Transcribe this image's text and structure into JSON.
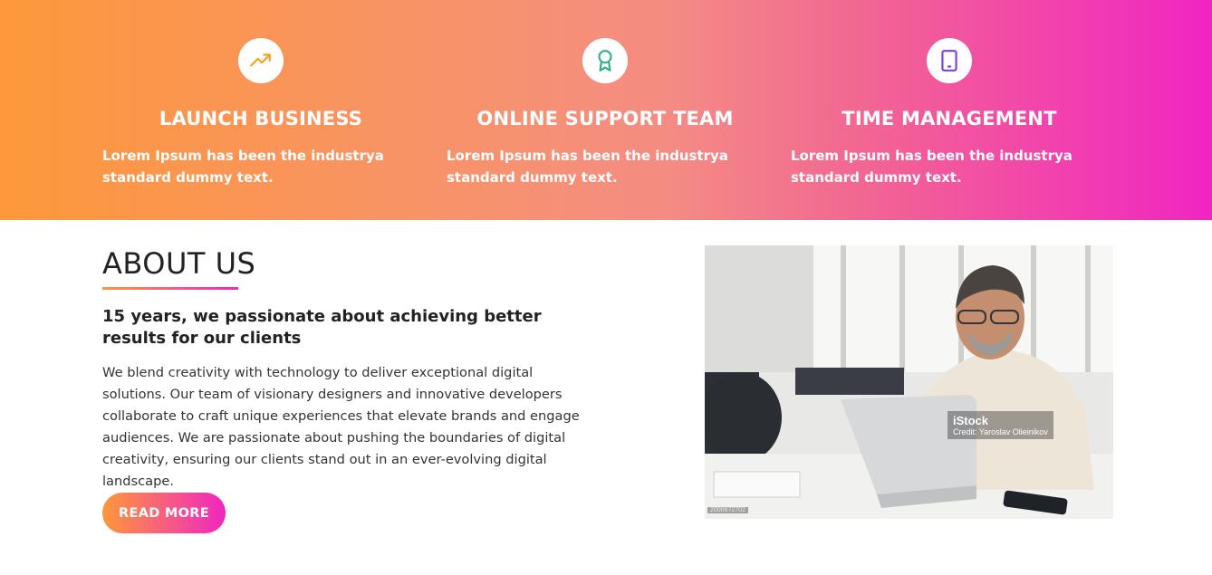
{
  "features": [
    {
      "icon": "trending-up-icon",
      "title": "LAUNCH BUSINESS",
      "text": "Lorem Ipsum has been the industrya standard dummy text."
    },
    {
      "icon": "award-icon",
      "title": "ONLINE SUPPORT TEAM",
      "text": "Lorem Ipsum has been the industrya standard dummy text."
    },
    {
      "icon": "tablet-icon",
      "title": "TIME MANAGEMENT",
      "text": "Lorem Ipsum has been the industrya standard dummy text."
    }
  ],
  "about": {
    "title": "ABOUT US",
    "subtitle": "15 years, we passionate about achieving better results for our clients",
    "body": "We blend creativity with technology to deliver exceptional digital solutions. Our team of visionary designers and innovative developers collaborate to craft unique experiences that elevate brands and engage audiences. We are passionate about pushing the boundaries of digital creativity, ensuring our clients stand out in an ever-evolving digital landscape.",
    "button_label": "READ MORE"
  },
  "photo": {
    "brand": "iStock",
    "credit": "Credit: Yaroslav Olieinikov",
    "id": "2000672702"
  },
  "colors": {
    "gradient_start": "#fd983b",
    "gradient_end": "#f125c2",
    "icon_orange": "#f6a21e",
    "icon_green": "#2fb184",
    "icon_purple": "#7b3fe4"
  }
}
